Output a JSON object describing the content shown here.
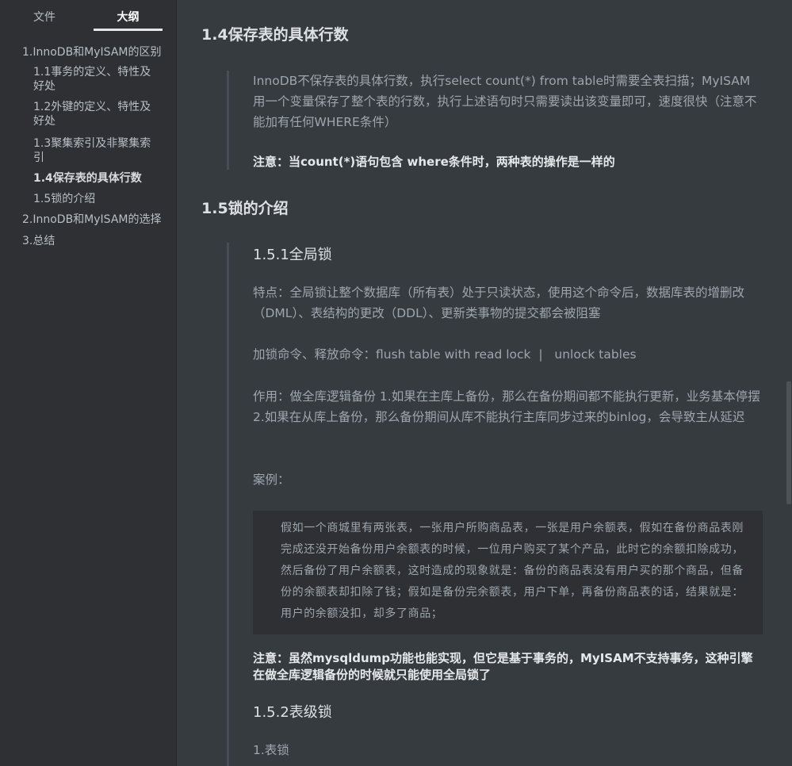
{
  "sidebar": {
    "tabs": {
      "file": "文件",
      "outline": "大纲"
    },
    "outline": [
      "1.InnoDB和MyISAM的区别",
      "1.1事务的定义、特性及好处",
      "1.2外键的定义、特性及好处",
      "1.3聚集索引及非聚集索引",
      "1.4保存表的具体行数",
      "1.5锁的介绍",
      "2.InnoDB和MyISAM的选择",
      "3.总结"
    ]
  },
  "content": {
    "section_14": {
      "title": "1.4保存表的具体行数",
      "quote": "InnoDB不保存表的具体行数，执行select count(*) from table时需要全表扫描；MyISAM用一个变量保存了整个表的行数，执行上述语句时只需要读出该变量即可，速度很快（注意不能加有任何WHERE条件）",
      "note": "注意：当count(*)语句包含 where条件时，两种表的操作是一样的"
    },
    "section_15": {
      "title": "1.5锁的介绍",
      "sub_151": {
        "title": "1.5.1全局锁",
        "features": "特点：全局锁让整个数据库（所有表）处于只读状态，使用这个命令后，数据库表的增删改（DML）、表结构的更改（DDL）、更新类事物的提交都会被阻塞",
        "commands": "加锁命令、释放命令：flush table with read lock  |   unlock tables",
        "usage": "作用：做全库逻辑备份  1.如果在主库上备份，那么在备份期间都不能执行更新，业务基本停摆 2.如果在从库上备份，那么备份期间从库不能执行主库同步过来的binlog，会导致主从延迟",
        "case_label": "案例：",
        "case_text": "假如一个商城里有两张表，一张用户所购商品表，一张是用户余额表，假如在备份商品表刚完成还没开始备份用户余额表的时候，一位用户购买了某个产品，此时它的余额扣除成功，然后备份了用户余额表，这时造成的现象就是：备份的商品表没有用户买的那个商品，但备份的余额表却扣除了钱；假如是备份完余额表，用户下单，再备份商品表的话，结果就是：用户的余额没扣，却多了商品；",
        "note": "注意：虽然mysqldump功能也能实现，但它是基于事务的，MyISAM不支持事务，这种引擎在做全库逻辑备份的时候就只能使用全局锁了"
      },
      "sub_152": {
        "title": "1.5.2表级锁",
        "item1": "1.表锁"
      }
    }
  }
}
